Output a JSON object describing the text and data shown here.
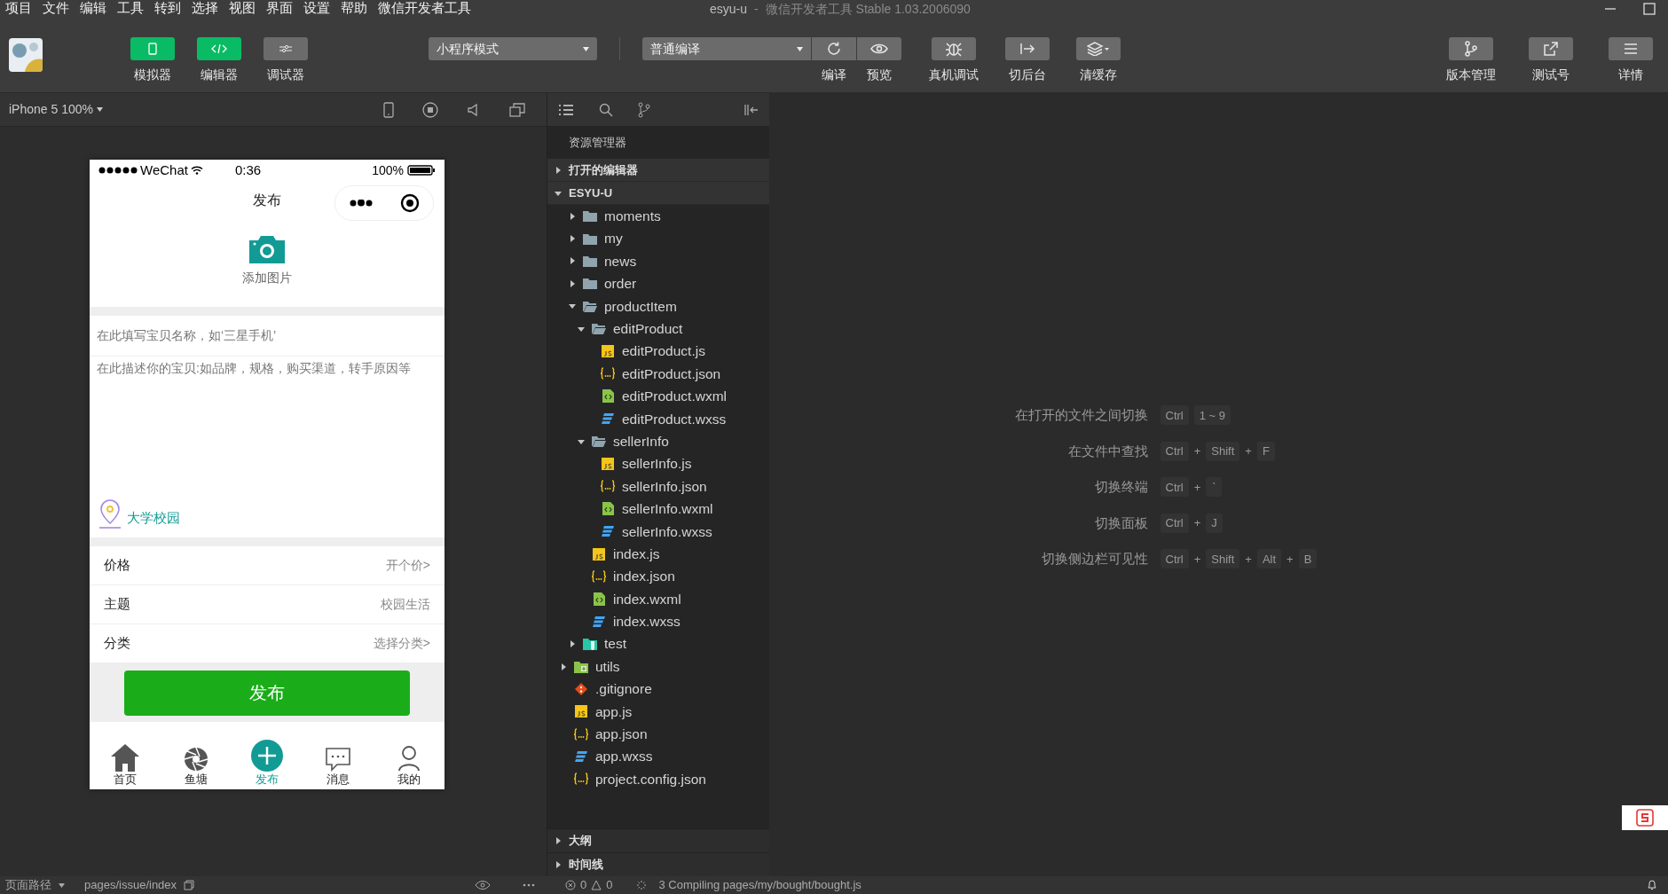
{
  "menu": [
    "项目",
    "文件",
    "编辑",
    "工具",
    "转到",
    "选择",
    "视图",
    "界面",
    "设置",
    "帮助",
    "微信开发者工具"
  ],
  "window": {
    "title": "esyu-u",
    "separator": "-",
    "subtitle": "微信开发者工具 Stable 1.03.2006090"
  },
  "toolbar": {
    "view_buttons": [
      {
        "label": "模拟器",
        "selected": true
      },
      {
        "label": "编辑器",
        "selected": true
      },
      {
        "label": "调试器",
        "selected": false
      }
    ],
    "mode": "小程序模式",
    "compile": "普通编译",
    "actions": [
      {
        "kind": "compile",
        "label": "编译"
      },
      {
        "kind": "preview",
        "label": "预览"
      },
      {
        "kind": "debug",
        "label": "真机调试"
      },
      {
        "kind": "background",
        "label": "切后台"
      },
      {
        "kind": "cache",
        "label": "清缓存"
      }
    ],
    "right_actions": [
      {
        "kind": "version",
        "label": "版本管理"
      },
      {
        "kind": "test",
        "label": "测试号"
      },
      {
        "kind": "details",
        "label": "详情"
      }
    ]
  },
  "simulator": {
    "device": "iPhone 5 100%",
    "phone": {
      "carrier": "WeChat",
      "time": "0:36",
      "battery": "100%",
      "nav_title": "发布",
      "add_image": "添加图片",
      "name_placeholder": "在此填写宝贝名称，如‘三星手机’",
      "desc_placeholder": "在此描述你的宝贝:如品牌，规格，购买渠道，转手原因等",
      "location": "大学校园",
      "rows": [
        {
          "label": "价格",
          "value": "开个价>"
        },
        {
          "label": "主题",
          "value": "校园生活"
        },
        {
          "label": "分类",
          "value": "选择分类>"
        }
      ],
      "submit": "发布",
      "tabs": [
        {
          "kind": "home",
          "label": "首页",
          "selected": false
        },
        {
          "kind": "aperture",
          "label": "鱼塘",
          "selected": false
        },
        {
          "kind": "plus",
          "label": "发布",
          "selected": true
        },
        {
          "kind": "chat",
          "label": "消息",
          "selected": false
        },
        {
          "kind": "person",
          "label": "我的",
          "selected": false
        }
      ]
    }
  },
  "explorer": {
    "title": "资源管理器",
    "sections": [
      {
        "label": "打开的编辑器",
        "expanded": false
      },
      {
        "label": "ESYU-U",
        "expanded": true
      }
    ],
    "tree": [
      {
        "kind": "hidden",
        "children": [
          {
            "kind": "folder",
            "name": "moments",
            "expanded": false
          },
          {
            "kind": "folder",
            "name": "my",
            "expanded": false
          },
          {
            "kind": "folder",
            "name": "news",
            "expanded": false
          },
          {
            "kind": "folder",
            "name": "order",
            "expanded": false
          },
          {
            "kind": "folder",
            "name": "productItem",
            "expanded": true,
            "children": [
              {
                "kind": "folder",
                "name": "editProduct",
                "expanded": true,
                "children": [
                  {
                    "kind": "js",
                    "name": "editProduct.js"
                  },
                  {
                    "kind": "json",
                    "name": "editProduct.json"
                  },
                  {
                    "kind": "wxml",
                    "name": "editProduct.wxml"
                  },
                  {
                    "kind": "wxss",
                    "name": "editProduct.wxss"
                  }
                ]
              },
              {
                "kind": "folder",
                "name": "sellerInfo",
                "expanded": true,
                "children": [
                  {
                    "kind": "js",
                    "name": "sellerInfo.js"
                  },
                  {
                    "kind": "json",
                    "name": "sellerInfo.json"
                  },
                  {
                    "kind": "wxml",
                    "name": "sellerInfo.wxml"
                  },
                  {
                    "kind": "wxss",
                    "name": "sellerInfo.wxss"
                  }
                ]
              },
              {
                "kind": "js",
                "name": "index.js"
              },
              {
                "kind": "json",
                "name": "index.json"
              },
              {
                "kind": "wxml",
                "name": "index.wxml"
              },
              {
                "kind": "wxss",
                "name": "index.wxss"
              }
            ]
          },
          {
            "kind": "testfolder",
            "name": "test",
            "expanded": false
          }
        ]
      },
      {
        "kind": "utilsfolder",
        "name": "utils",
        "expanded": false
      },
      {
        "kind": "git",
        "name": ".gitignore"
      },
      {
        "kind": "js",
        "name": "app.js"
      },
      {
        "kind": "json",
        "name": "app.json"
      },
      {
        "kind": "wxss",
        "name": "app.wxss"
      },
      {
        "kind": "json",
        "name": "project.config.json"
      }
    ],
    "bottom_sections": [
      {
        "label": "大纲",
        "expanded": false
      },
      {
        "label": "时间线",
        "expanded": false
      }
    ]
  },
  "shortcuts": [
    {
      "label": "在打开的文件之间切换",
      "keys": [
        "Ctrl",
        "1 ~ 9"
      ],
      "joined": false
    },
    {
      "label": "在文件中查找",
      "keys": [
        "Ctrl",
        "Shift",
        "F"
      ],
      "joined": true
    },
    {
      "label": "切换终端",
      "keys": [
        "Ctrl",
        "`"
      ],
      "joined": true
    },
    {
      "label": "切换面板",
      "keys": [
        "Ctrl",
        "J"
      ],
      "joined": true
    },
    {
      "label": "切换侧边栏可见性",
      "keys": [
        "Ctrl",
        "Shift",
        "Alt",
        "B"
      ],
      "joined": true
    }
  ],
  "joiner": "+",
  "status_bar": {
    "path_label": "页面路径",
    "path": "pages/issue/index",
    "errors": "0",
    "warnings": "0",
    "message": "3 Compiling pages/my/bought/bought.js"
  }
}
